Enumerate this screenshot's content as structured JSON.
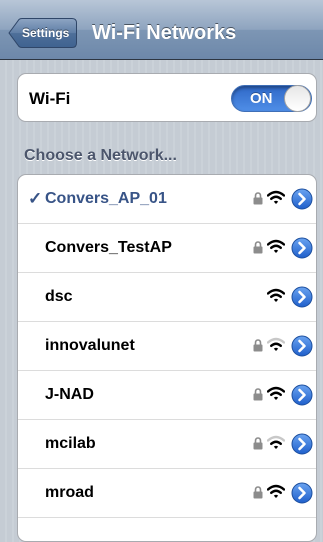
{
  "nav": {
    "back_label": "Settings",
    "title": "Wi-Fi Networks"
  },
  "wifi": {
    "label": "Wi-Fi",
    "toggle_text": "ON",
    "enabled": true
  },
  "section_header": "Choose a Network...",
  "colors": {
    "accent_blue": "#385487",
    "toggle_blue": "#3b7bd9",
    "disclosure_blue": "#2a73de"
  },
  "networks": [
    {
      "name": "Convers_AP_01",
      "selected": true,
      "check": "✓",
      "locked": true,
      "signal": "full"
    },
    {
      "name": "Convers_TestAP",
      "selected": false,
      "locked": true,
      "signal": "full"
    },
    {
      "name": "dsc",
      "selected": false,
      "locked": false,
      "signal": "full"
    },
    {
      "name": "innovalunet",
      "selected": false,
      "locked": true,
      "signal": "weak"
    },
    {
      "name": "J-NAD",
      "selected": false,
      "locked": true,
      "signal": "full"
    },
    {
      "name": "mcilab",
      "selected": false,
      "locked": true,
      "signal": "weak"
    },
    {
      "name": "mroad",
      "selected": false,
      "locked": true,
      "signal": "full"
    }
  ]
}
